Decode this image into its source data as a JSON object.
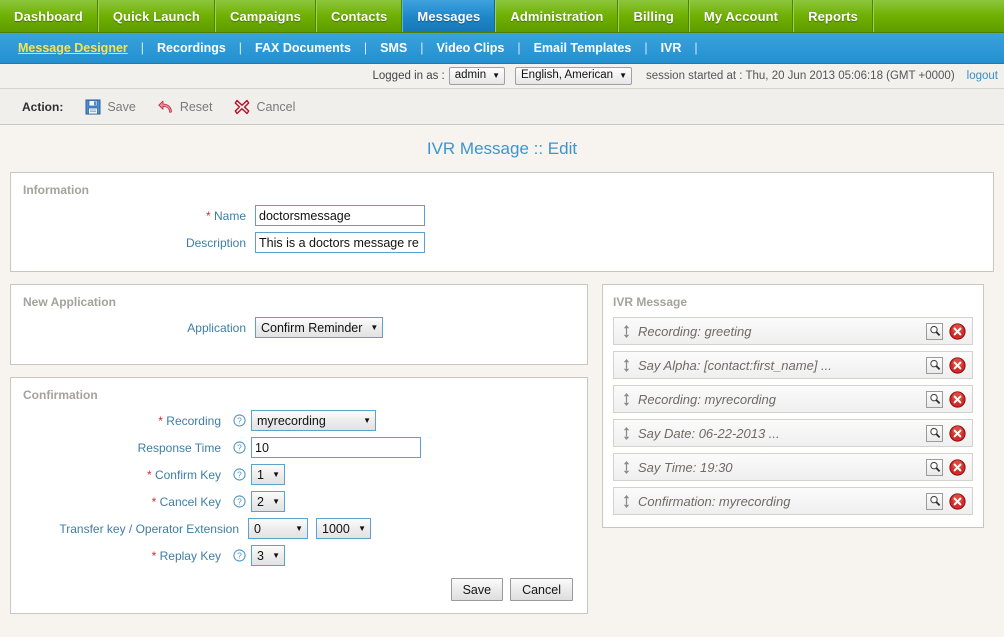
{
  "topnav": {
    "tabs": [
      {
        "label": "Dashboard",
        "active": false
      },
      {
        "label": "Quick Launch",
        "active": false
      },
      {
        "label": "Campaigns",
        "active": false
      },
      {
        "label": "Contacts",
        "active": false
      },
      {
        "label": "Messages",
        "active": true
      },
      {
        "label": "Administration",
        "active": false
      },
      {
        "label": "Billing",
        "active": false
      },
      {
        "label": "My Account",
        "active": false
      },
      {
        "label": "Reports",
        "active": false
      }
    ]
  },
  "subnav": {
    "items": [
      {
        "label": "Message Designer",
        "current": true
      },
      {
        "label": "Recordings",
        "current": false
      },
      {
        "label": "FAX Documents",
        "current": false
      },
      {
        "label": "SMS",
        "current": false
      },
      {
        "label": "Video Clips",
        "current": false
      },
      {
        "label": "Email Templates",
        "current": false
      },
      {
        "label": "IVR",
        "current": false
      }
    ],
    "separator": "|"
  },
  "session": {
    "logged_in_label": "Logged in as :",
    "user": "admin",
    "language": "English, American",
    "started": "session started at : Thu, 20 Jun 2013 05:06:18 (GMT +0000)",
    "logout": "logout"
  },
  "actionbar": {
    "label": "Action:",
    "save": "Save",
    "reset": "Reset",
    "cancel": "Cancel"
  },
  "page": {
    "title": "IVR Message :: Edit"
  },
  "information": {
    "title": "Information",
    "name_label": "Name",
    "name_value": "doctorsmessage",
    "description_label": "Description",
    "description_value": "This is a doctors message re"
  },
  "new_application": {
    "title": "New Application",
    "application_label": "Application",
    "application_value": "Confirm Reminder"
  },
  "confirmation": {
    "title": "Confirmation",
    "recording_label": "Recording",
    "recording_value": "myrecording",
    "response_time_label": "Response Time",
    "response_time_value": "10",
    "confirm_key_label": "Confirm Key",
    "confirm_key_value": "1",
    "cancel_key_label": "Cancel Key",
    "cancel_key_value": "2",
    "transfer_label": "Transfer key / Operator Extension",
    "transfer_key_value": "0",
    "operator_ext_value": "1000",
    "replay_key_label": "Replay Key",
    "replay_key_value": "3",
    "save_button": "Save",
    "cancel_button": "Cancel"
  },
  "ivr_message": {
    "title": "IVR Message",
    "items": [
      {
        "label": "Recording: greeting"
      },
      {
        "label": "Say Alpha: [contact:first_name] ..."
      },
      {
        "label": "Recording: myrecording"
      },
      {
        "label": "Say Date: 06-22-2013 ..."
      },
      {
        "label": "Say Time: 19:30"
      },
      {
        "label": "Confirmation: myrecording"
      }
    ]
  },
  "colors": {
    "nav_green": "#6fb000",
    "nav_active_blue": "#1e86c8",
    "subnav_blue": "#2e99d6",
    "title_blue": "#3a96cf",
    "label_blue": "#3d7ea6",
    "required_red": "#d32b2b",
    "page_bg": "#f7f4ef"
  }
}
